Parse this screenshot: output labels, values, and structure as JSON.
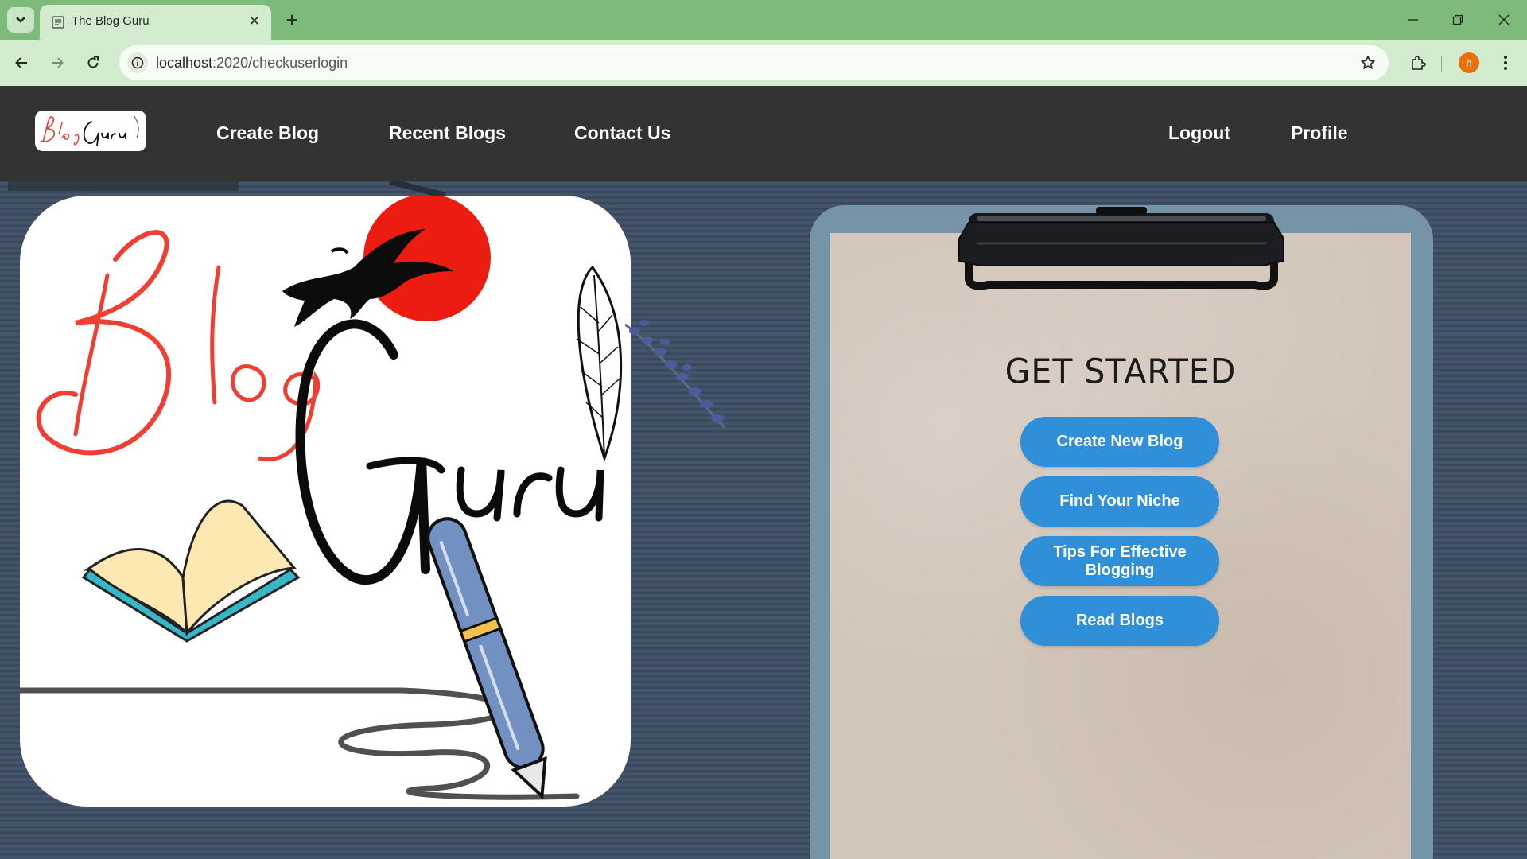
{
  "browser": {
    "tab_title": "The Blog Guru",
    "tab_close": "✕",
    "new_tab": "+",
    "url_host": "localhost",
    "url_path": ":2020/checkuserlogin",
    "profile_initial": "h"
  },
  "navbar": {
    "links": [
      "Create Blog",
      "Recent Blogs",
      "Contact Us"
    ],
    "right_links": [
      "Logout",
      "Profile"
    ]
  },
  "panel": {
    "heading": "GET STARTED",
    "buttons": [
      "Create New Blog",
      "Find Your Niche",
      "Tips For Effective Blogging",
      "Read Blogs"
    ]
  },
  "logo_text": [
    "Blog",
    "Guru"
  ],
  "colors": {
    "tabstrip": "#7ebb7b",
    "toolbar": "#d3ebce",
    "navbar": "#333333",
    "button": "#2f8fd9",
    "clipboard": "#7594a8",
    "paper": "#d2c5b9"
  },
  "icons": [
    "tab-search-icon",
    "page-favicon-icon",
    "back-arrow-icon",
    "forward-arrow-icon",
    "reload-icon",
    "site-info-icon",
    "bookmark-star-icon",
    "extensions-icon",
    "more-menu-icon",
    "minimize-icon",
    "restore-icon",
    "close-window-icon"
  ]
}
